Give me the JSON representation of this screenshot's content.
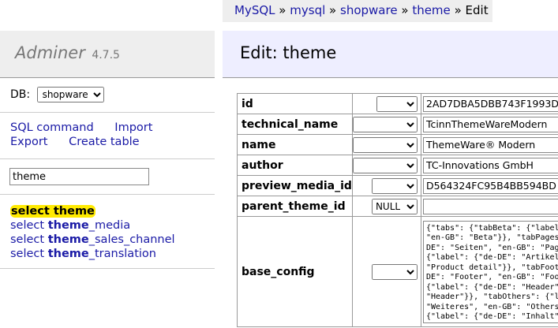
{
  "breadcrumb": {
    "items": [
      "MySQL",
      "mysql",
      "shopware",
      "theme"
    ],
    "current": "Edit",
    "separator": "»"
  },
  "app": {
    "name": "Adminer",
    "version": "4.7.5"
  },
  "db": {
    "label": "DB:",
    "selected": "shopware"
  },
  "links": {
    "sql_command": "SQL command",
    "import": "Import",
    "export": "Export",
    "create_table": "Create table"
  },
  "filter": {
    "value": "theme"
  },
  "tables": [
    {
      "prefix": "select ",
      "bold": "theme",
      "rest": ""
    },
    {
      "prefix": "select ",
      "bold": "theme",
      "rest": "_media"
    },
    {
      "prefix": "select ",
      "bold": "theme",
      "rest": "_sales_channel"
    },
    {
      "prefix": "select ",
      "bold": "theme",
      "rest": "_translation"
    }
  ],
  "page": {
    "title": "Edit: theme"
  },
  "fields": [
    {
      "name": "id",
      "function": "",
      "value": "2AD7DBA5DBB743F1993D"
    },
    {
      "name": "technical_name",
      "function": "",
      "value": "TcinnThemeWareModern"
    },
    {
      "name": "name",
      "function": "",
      "value": "ThemeWare® Modern"
    },
    {
      "name": "author",
      "function": "",
      "value": "TC-Innovations GmbH"
    },
    {
      "name": "preview_media_id",
      "function": "",
      "value": "D564324FC95B4BB594BD"
    },
    {
      "name": "parent_theme_id",
      "function": "NULL",
      "value": ""
    },
    {
      "name": "base_config",
      "function": "",
      "value": "{\"tabs\": {\"tabBeta\": {\"label\n\"en-GB\": \"Beta\"}}, \"tabPages\nDE\": \"Seiten\", \"en-GB\": \"Pag\n{\"label\": {\"de-DE\": \"Artikel\n\"Product detail\"}}, \"tabFoot\nDE\": \"Footer\", \"en-GB\": \"Foo\n{\"label\": {\"de-DE\": \"Header\"\n\"Header\"}}, \"tabOthers\": {\"l\n\"Weiteres\", \"en-GB\": \"Others\n{\"label\": {\"de-DE\": \"Inhalt\""
    }
  ]
}
